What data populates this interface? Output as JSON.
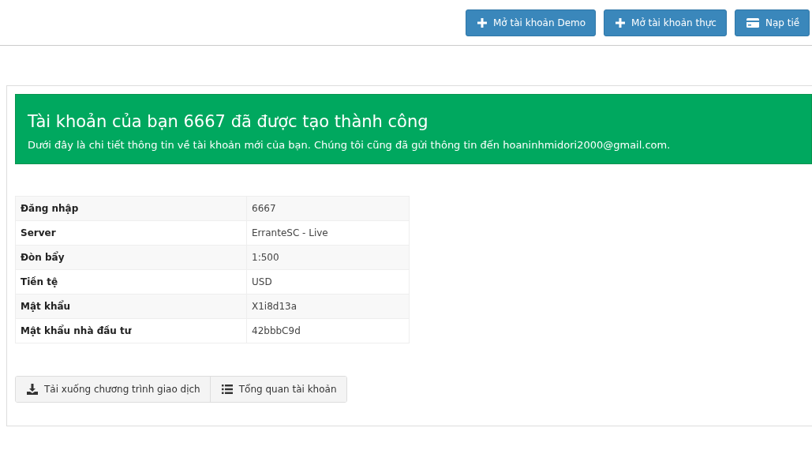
{
  "header_buttons": [
    {
      "kind": "plus",
      "label": "Mở tài khoản Demo"
    },
    {
      "kind": "plus",
      "label": "Mở tài khoản thực"
    },
    {
      "kind": "card",
      "label": "Nạp tiề"
    }
  ],
  "alert": {
    "title": "Tài khoản của bạn 6667 đã được tạo thành công",
    "message": "Dưới đây là chi tiết thông tin về tài khoản mới của bạn. Chúng tôi cũng đã gửi thông tin đến hoaninhmidori2000@gmail.com."
  },
  "details": [
    {
      "label": "Đăng nhập",
      "value": "6667"
    },
    {
      "label": "Server",
      "value": "ErranteSC - Live"
    },
    {
      "label": "Đòn bẩy",
      "value": "1:500"
    },
    {
      "label": "Tiền tệ",
      "value": "USD"
    },
    {
      "label": "Mật khẩu",
      "value": "X1i8d13a"
    },
    {
      "label": "Mật khẩu nhà đầu tư",
      "value": "42bbbC9d"
    }
  ],
  "actions": [
    {
      "kind": "download",
      "label": "Tải xuống chương trình giao dịch"
    },
    {
      "kind": "list",
      "label": "Tổng quan tài khoản"
    }
  ]
}
